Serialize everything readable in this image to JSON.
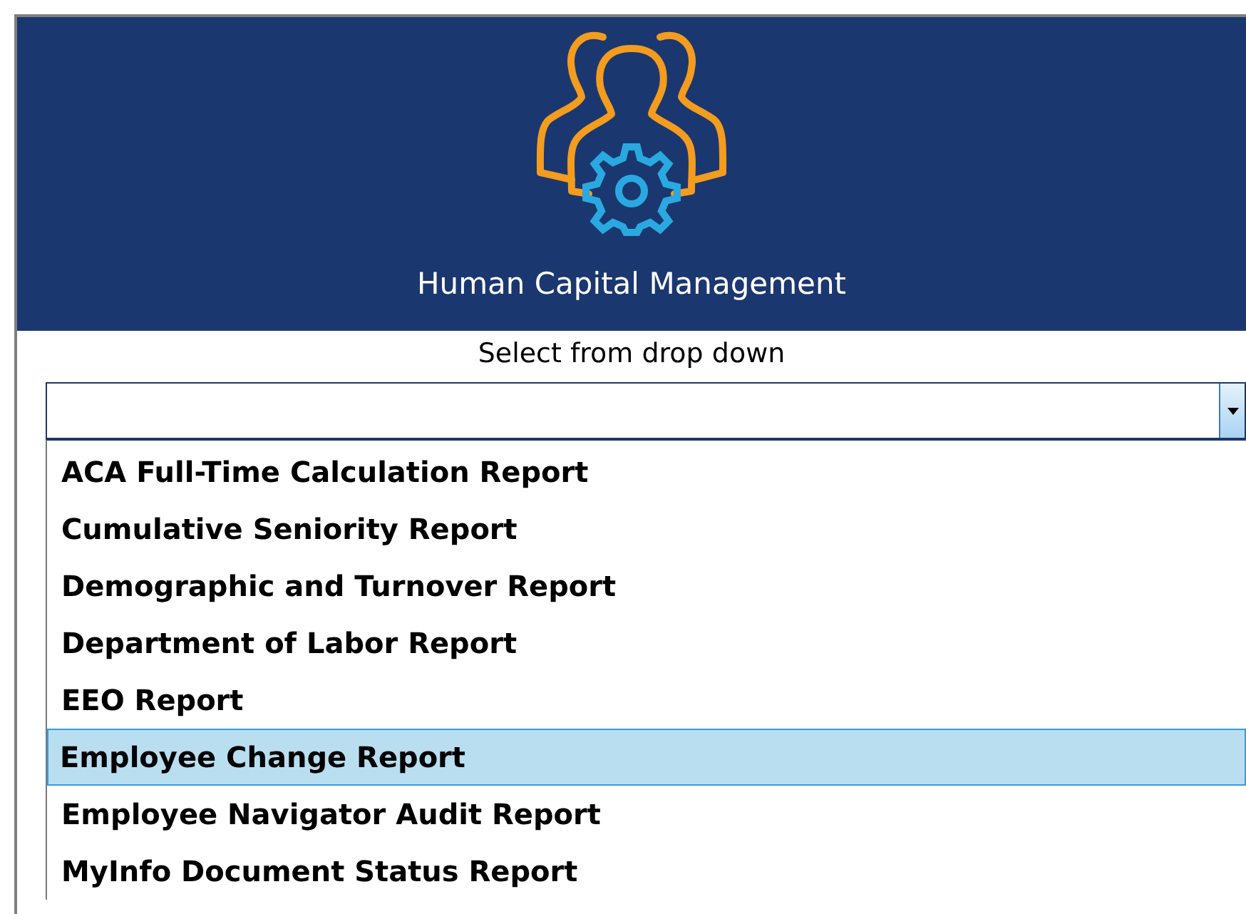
{
  "header": {
    "title": "Human Capital Management"
  },
  "dropdown": {
    "label": "Select from drop down",
    "expanded": true
  },
  "options": [
    {
      "label": "ACA Full-Time Calculation Report",
      "selected": false
    },
    {
      "label": "Cumulative Seniority Report",
      "selected": false
    },
    {
      "label": "Demographic and Turnover Report",
      "selected": false
    },
    {
      "label": "Department of Labor Report",
      "selected": false
    },
    {
      "label": "EEO Report",
      "selected": false
    },
    {
      "label": "Employee Change Report",
      "selected": true
    },
    {
      "label": "Employee Navigator Audit Report",
      "selected": false
    },
    {
      "label": "MyInfo Document Status Report",
      "selected": false
    }
  ]
}
